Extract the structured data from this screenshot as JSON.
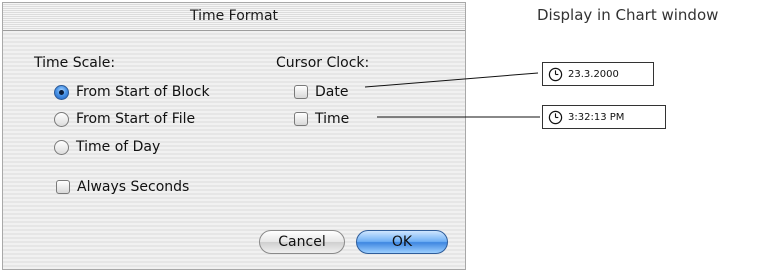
{
  "dialog": {
    "title": "Time Format",
    "time_scale": {
      "label": "Time Scale:",
      "options": [
        {
          "label": "From Start of Block",
          "selected": true
        },
        {
          "label": "From Start of File",
          "selected": false
        },
        {
          "label": "Time of Day",
          "selected": false
        }
      ]
    },
    "cursor_clock": {
      "label": "Cursor Clock:",
      "options": [
        {
          "label": "Date",
          "checked": false
        },
        {
          "label": "Time",
          "checked": false
        }
      ]
    },
    "always_seconds": {
      "label": "Always Seconds",
      "checked": false
    },
    "buttons": {
      "cancel_label": "Cancel",
      "ok_label": "OK"
    }
  },
  "annotation": {
    "caption": "Display in Chart window",
    "date_example": "23.3.2000",
    "time_example": "3:32:13 PM",
    "clock_icon": "clock-icon"
  },
  "colors": {
    "default_button": "#4b95e8",
    "dialog_background": "#ececec"
  }
}
